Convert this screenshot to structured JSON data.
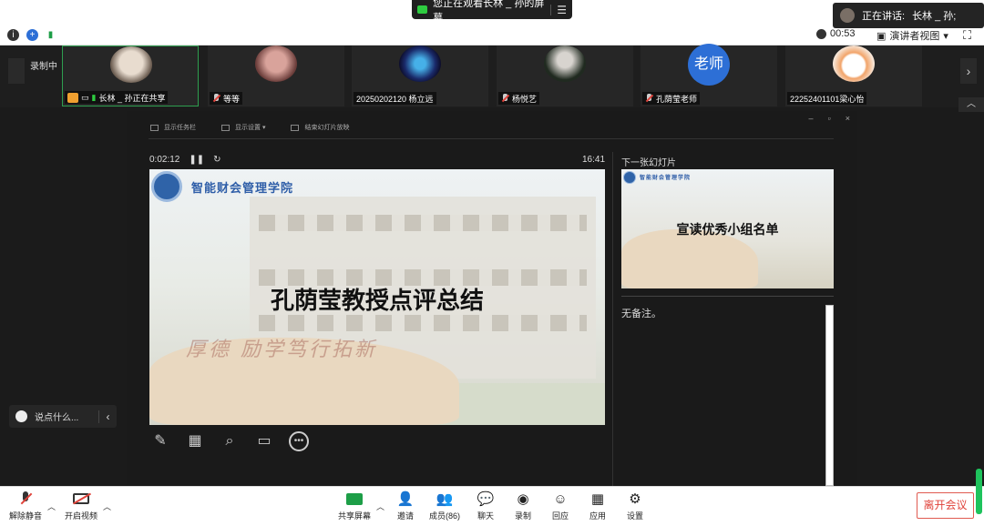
{
  "topbar": {
    "viewing_text": "您正在观看长林 _ 孙的屏幕",
    "speaking_label": "正在讲话:",
    "speaking_name": "长林 _ 孙;"
  },
  "infobar": {
    "timer": "00:53",
    "view_mode": "演讲者视图",
    "view_mode_caret": "▾"
  },
  "strip": {
    "recording": "录制中",
    "participants": [
      {
        "name": "长林 _ 孙正在共享"
      },
      {
        "name": "等等"
      },
      {
        "name": "20250202120 杨立远"
      },
      {
        "name": "杨悦艺"
      },
      {
        "name": "孔荫莹老师",
        "avatar_text": "老师"
      },
      {
        "name": "22252401101梁心怡"
      }
    ]
  },
  "presenter": {
    "toolbar": [
      "显示任务栏",
      "显示设置 ▾",
      "结束幻灯片放映"
    ],
    "elapsed": "0:02:12",
    "clock": "16:41",
    "next_label": "下一张幻灯片",
    "slide_school": "智能财会管理学院",
    "slide_title": "孔荫莹教授点评总结",
    "slide_motto": "厚德 励学笃行拓新",
    "next_title": "宣读优秀小组名单",
    "notes": "无备注。"
  },
  "chat": {
    "placeholder": "说点什么...",
    "chevron": "‹"
  },
  "bottombar": {
    "unmute": "解除静音",
    "start_video": "开启视频",
    "share": "共享屏幕",
    "invite": "邀请",
    "members": "成员(86)",
    "chat": "聊天",
    "record": "录制",
    "replay": "回应",
    "apps": "应用",
    "settings": "设置",
    "leave": "离开会议"
  },
  "colors": {
    "accent_green": "#1d9e47",
    "leave_red": "#e0433b",
    "teacher_blue": "#2d6fd6"
  }
}
